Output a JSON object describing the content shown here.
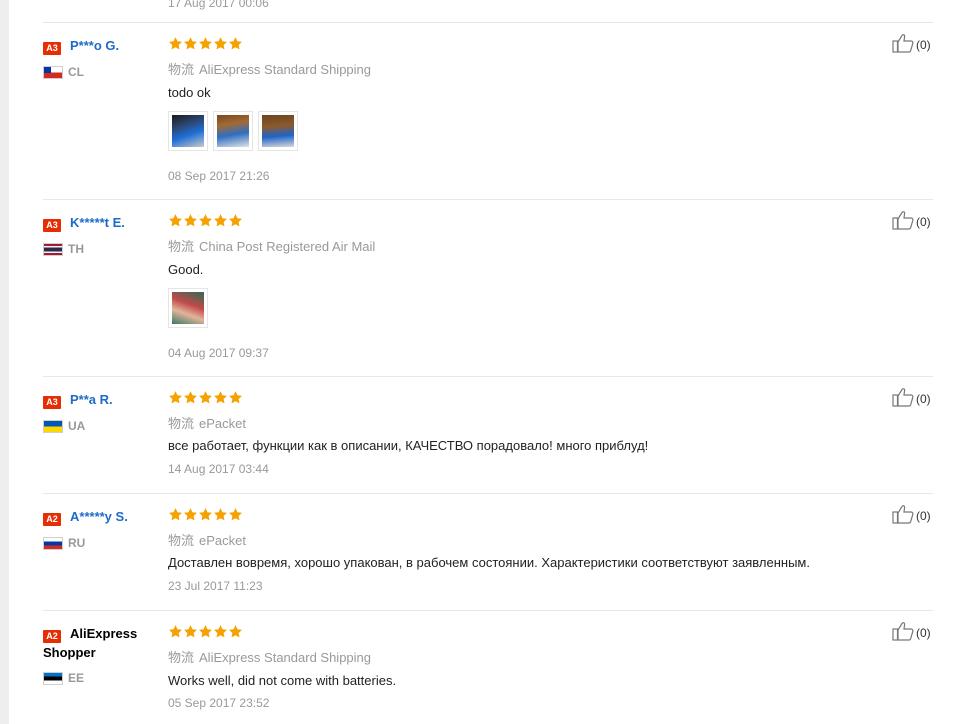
{
  "previous_review": {
    "date": "17 Aug 2017 00:06"
  },
  "shipping_label": "物流",
  "colors": {
    "badge": "#e62e04",
    "name_link": "#1e6bc6",
    "star": "#f5a100",
    "muted": "#999999"
  },
  "reviews": [
    {
      "level": "A3",
      "name": "P***o G.",
      "country": "CL",
      "flag_colors": [
        "#d52b1e",
        "#ffffff",
        "#0039a6"
      ],
      "stars": 5,
      "shipping": "AliExpress Standard Shipping",
      "text": "todo ok",
      "photos": [
        "photo-1",
        "photo-2",
        "photo-3"
      ],
      "date": "08 Sep 2017 21:26",
      "helpful": "(0)"
    },
    {
      "level": "A3",
      "name": "K*****t E.",
      "country": "TH",
      "flag_colors": [
        "#a51931",
        "#f4f5f8",
        "#2d2a4a"
      ],
      "stars": 5,
      "shipping": "China Post Registered Air Mail",
      "text": "Good.",
      "photos": [
        "photo-1"
      ],
      "date": "04 Aug 2017 09:37",
      "helpful": "(0)"
    },
    {
      "level": "A3",
      "name": "P**a R.",
      "country": "UA",
      "flag_colors": [
        "#0057b7",
        "#ffd700"
      ],
      "stars": 5,
      "shipping": "ePacket",
      "text": "все работает, функции как в описании, КАЧЕСТВО порадовало! много приблуд!",
      "photos": [],
      "date": "14 Aug 2017 03:44",
      "helpful": "(0)"
    },
    {
      "level": "A2",
      "name": "A*****y S.",
      "country": "RU",
      "flag_colors": [
        "#ffffff",
        "#0039a6",
        "#d52b1e"
      ],
      "stars": 5,
      "shipping": "ePacket",
      "text": "Доставлен вовремя, хорошо упакован, в рабочем состоянии. Характеристики соответствуют заявленным.",
      "photos": [],
      "date": "23 Jul 2017 11:23",
      "helpful": "(0)"
    },
    {
      "level": "A2",
      "name": "AliExpress Shopper",
      "country": "EE",
      "flag_colors": [
        "#0072ce",
        "#000000",
        "#ffffff"
      ],
      "stars": 5,
      "shipping": "AliExpress Standard Shipping",
      "text": "Works well, did not come with batteries.",
      "photos": [],
      "date": "05 Sep 2017 23:52",
      "helpful": "(0)"
    }
  ]
}
